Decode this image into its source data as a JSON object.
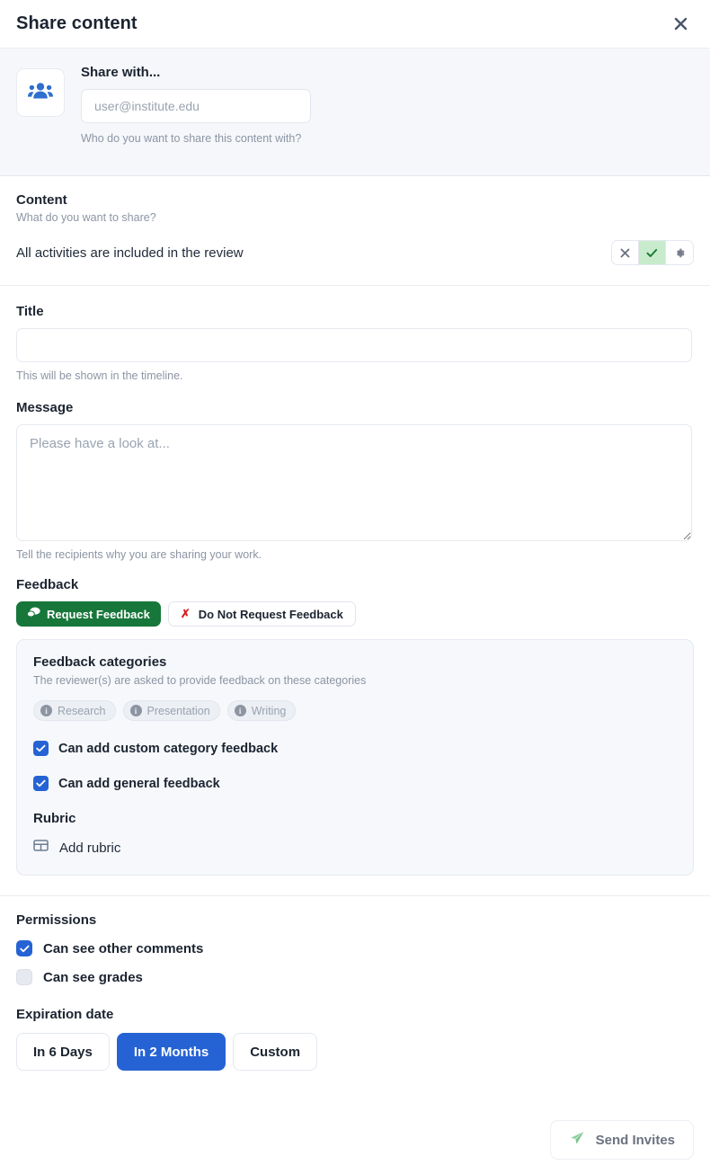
{
  "header": {
    "title": "Share content",
    "close_icon": "close-icon"
  },
  "share_with": {
    "label": "Share with...",
    "icon": "users-group-icon",
    "input_value": "",
    "placeholder": "user@institute.edu",
    "help": "Who do you want to share this content with?"
  },
  "content": {
    "title": "Content",
    "subtitle": "What do you want to share?",
    "row_text": "All activities are included in the review",
    "toggle_group": [
      {
        "icon": "x-icon",
        "glyph": "✕",
        "state": "inactive"
      },
      {
        "icon": "check-icon",
        "glyph": "✓",
        "state": "active"
      },
      {
        "icon": "gear-icon",
        "glyph": "⚙",
        "state": "inactive"
      }
    ]
  },
  "title_field": {
    "label": "Title",
    "value": "",
    "placeholder": "",
    "help": "This will be shown in the timeline."
  },
  "message_field": {
    "label": "Message",
    "value": "",
    "placeholder": "Please have a look at...",
    "help": "Tell the recipients why you are sharing your work."
  },
  "feedback": {
    "title": "Feedback",
    "request_label": "Request Feedback",
    "request_icon": "comments-icon",
    "do_not_request_label": "Do Not Request Feedback",
    "do_not_request_icon": "x-icon",
    "panel": {
      "title": "Feedback categories",
      "subtitle": "The reviewer(s) are asked to provide feedback on these categories",
      "categories": [
        {
          "label": "Research",
          "icon": "info-icon"
        },
        {
          "label": "Presentation",
          "icon": "info-icon"
        },
        {
          "label": "Writing",
          "icon": "info-icon"
        }
      ],
      "checkboxes": [
        {
          "label": "Can add custom category feedback",
          "checked": true
        },
        {
          "label": "Can add general feedback",
          "checked": true
        }
      ],
      "rubric_title": "Rubric",
      "add_rubric_label": "Add rubric",
      "add_rubric_icon": "table-icon"
    }
  },
  "permissions": {
    "title": "Permissions",
    "items": [
      {
        "label": "Can see other comments",
        "checked": true
      },
      {
        "label": "Can see grades",
        "checked": false
      }
    ]
  },
  "expiration": {
    "title": "Expiration date",
    "options": [
      {
        "label": "In 6 Days",
        "selected": false
      },
      {
        "label": "In 2 Months",
        "selected": true
      },
      {
        "label": "Custom",
        "selected": false
      }
    ]
  },
  "footer": {
    "send_label": "Send Invites",
    "send_icon": "paper-plane-icon"
  },
  "colors": {
    "accent_blue": "#2563d4",
    "green": "#17773a",
    "green_soft": "#c8ebcd",
    "red": "#d72020",
    "panel_bg": "#f6f8fb",
    "band_bg": "#f5f7fa"
  }
}
